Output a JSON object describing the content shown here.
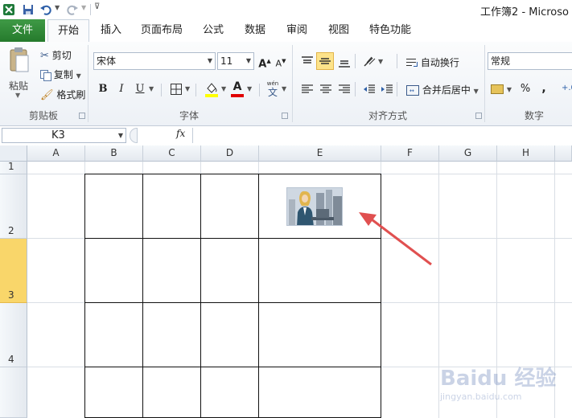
{
  "window": {
    "title": "工作簿2 - Microso"
  },
  "tabs": [
    {
      "label": "文件"
    },
    {
      "label": "开始"
    },
    {
      "label": "插入"
    },
    {
      "label": "页面布局"
    },
    {
      "label": "公式"
    },
    {
      "label": "数据"
    },
    {
      "label": "审阅"
    },
    {
      "label": "视图"
    },
    {
      "label": "特色功能"
    }
  ],
  "clipboard": {
    "paste": "粘贴",
    "cut": "剪切",
    "copy": "复制",
    "format_painter": "格式刷",
    "group": "剪贴板"
  },
  "font": {
    "name": "宋体",
    "size": "11",
    "group": "字体",
    "bold": "B",
    "italic": "I",
    "underline": "U",
    "grow": "A",
    "shrink": "A",
    "color_letter": "A",
    "phonetic": "wén",
    "phonetic_char": "文"
  },
  "alignment": {
    "wrap_text": "自动换行",
    "merge_center": "合并后居中",
    "group": "对齐方式"
  },
  "number": {
    "format": "常规",
    "percent": "%",
    "comma": ",",
    "group": "数字"
  },
  "formula_bar": {
    "name_box": "K3",
    "fx": "fx"
  },
  "columns": [
    "A",
    "B",
    "C",
    "D",
    "E",
    "F",
    "G",
    "H"
  ],
  "rows": [
    {
      "label": "1"
    },
    {
      "label": "2"
    },
    {
      "label": "3",
      "selected": true
    },
    {
      "label": "4"
    }
  ],
  "colors": {
    "accent_file_tab": "#2e7d32",
    "selected_row": "#f9d66a",
    "arrow": "#e05050",
    "fill_color": "#ffff00",
    "font_color": "#e00000"
  },
  "annotation": {
    "icon": "red-arrow-icon"
  },
  "watermark": {
    "brand": "Baidu 经验",
    "url": "jingyan.baidu.com"
  }
}
